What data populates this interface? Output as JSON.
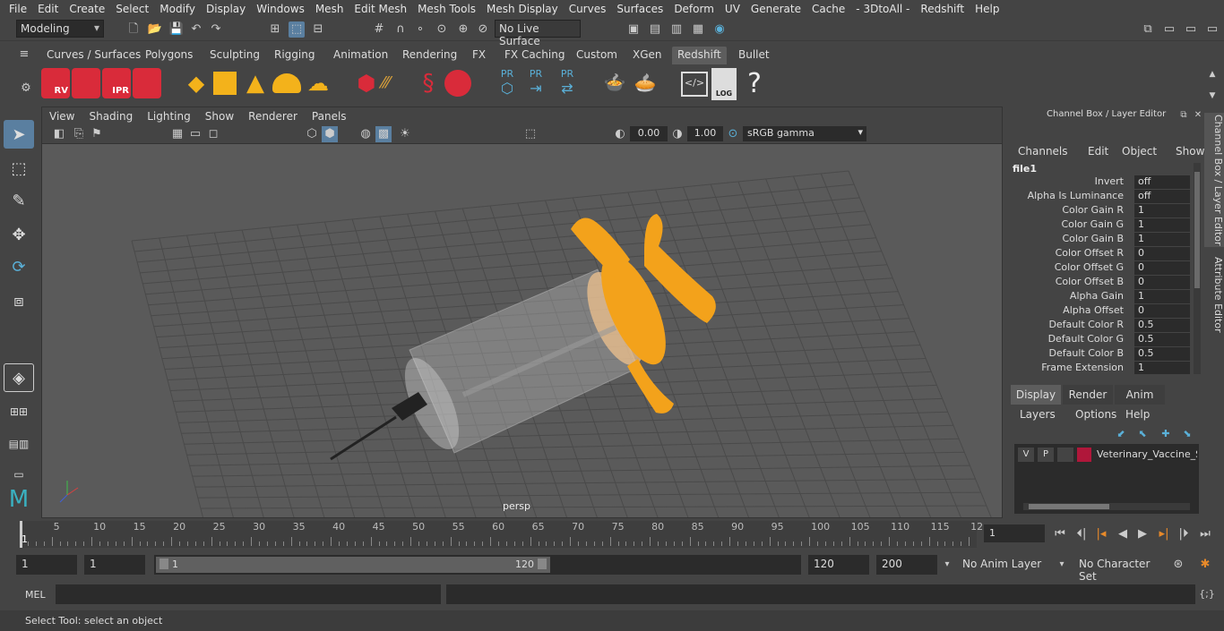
{
  "menu": [
    "File",
    "Edit",
    "Create",
    "Select",
    "Modify",
    "Display",
    "Windows",
    "Mesh",
    "Edit Mesh",
    "Mesh Tools",
    "Mesh Display",
    "Curves",
    "Surfaces",
    "Deform",
    "UV",
    "Generate",
    "Cache",
    "- 3DtoAll -",
    "Redshift",
    "Help"
  ],
  "mode_selector": "Modeling",
  "live_surface": "No Live Surface",
  "shelf_tabs": [
    "Curves / Surfaces",
    "Polygons",
    "Sculpting",
    "Rigging",
    "Animation",
    "Rendering",
    "FX",
    "FX Caching",
    "Custom",
    "XGen",
    "Redshift",
    "Bullet"
  ],
  "active_shelf_tab": "Redshift",
  "shelf_labels": {
    "rv": "RV",
    "ipr": "IPR",
    "pr1": "PR",
    "pr2": "PR",
    "pr3": "PR",
    "log": "LOG",
    "help": "?"
  },
  "viewport": {
    "menu": [
      "View",
      "Shading",
      "Lighting",
      "Show",
      "Renderer",
      "Panels"
    ],
    "exposure": "0.00",
    "gamma": "1.00",
    "color_space": "sRGB gamma",
    "camera_label": "persp"
  },
  "channel_box": {
    "title": "Channel Box / Layer Editor",
    "menu": [
      "Channels",
      "Edit",
      "Object",
      "Show"
    ],
    "node": "file1",
    "attributes": [
      {
        "label": "Invert",
        "value": "off"
      },
      {
        "label": "Alpha Is Luminance",
        "value": "off"
      },
      {
        "label": "Color Gain R",
        "value": "1"
      },
      {
        "label": "Color Gain G",
        "value": "1"
      },
      {
        "label": "Color Gain B",
        "value": "1"
      },
      {
        "label": "Color Offset R",
        "value": "0"
      },
      {
        "label": "Color Offset G",
        "value": "0"
      },
      {
        "label": "Color Offset B",
        "value": "0"
      },
      {
        "label": "Alpha Gain",
        "value": "1"
      },
      {
        "label": "Alpha Offset",
        "value": "0"
      },
      {
        "label": "Default Color R",
        "value": "0.5"
      },
      {
        "label": "Default Color G",
        "value": "0.5"
      },
      {
        "label": "Default Color B",
        "value": "0.5"
      },
      {
        "label": "Frame Extension",
        "value": "1"
      }
    ]
  },
  "layer_editor": {
    "tabs": [
      "Display",
      "Render",
      "Anim"
    ],
    "menu": [
      "Layers",
      "Options",
      "Help"
    ],
    "layer": {
      "v": "V",
      "p": "P",
      "name": "Veterinary_Vaccine_Syringe",
      "color": "#b0173a"
    }
  },
  "side_tabs": [
    "Channel Box / Layer Editor",
    "Attribute Editor"
  ],
  "timeline": {
    "ticks": [
      "5",
      "10",
      "15",
      "20",
      "25",
      "30",
      "35",
      "40",
      "45",
      "50",
      "55",
      "60",
      "65",
      "70",
      "75",
      "80",
      "85",
      "90",
      "95",
      "100",
      "105",
      "110",
      "115",
      "12"
    ],
    "first_tick": "1",
    "current_frame": "1"
  },
  "range": {
    "start": "1",
    "playback_start": "1",
    "slider_start": "1",
    "slider_end": "120",
    "playback_end": "120",
    "end": "200",
    "anim_layer": "No Anim Layer",
    "char_set": "No Character Set"
  },
  "mel_label": "MEL",
  "status_text": "Select Tool: select an object",
  "colors": {
    "accent": "#5ab0d8",
    "syringe": "#f3a21b",
    "rs_red": "#d92b3a"
  }
}
